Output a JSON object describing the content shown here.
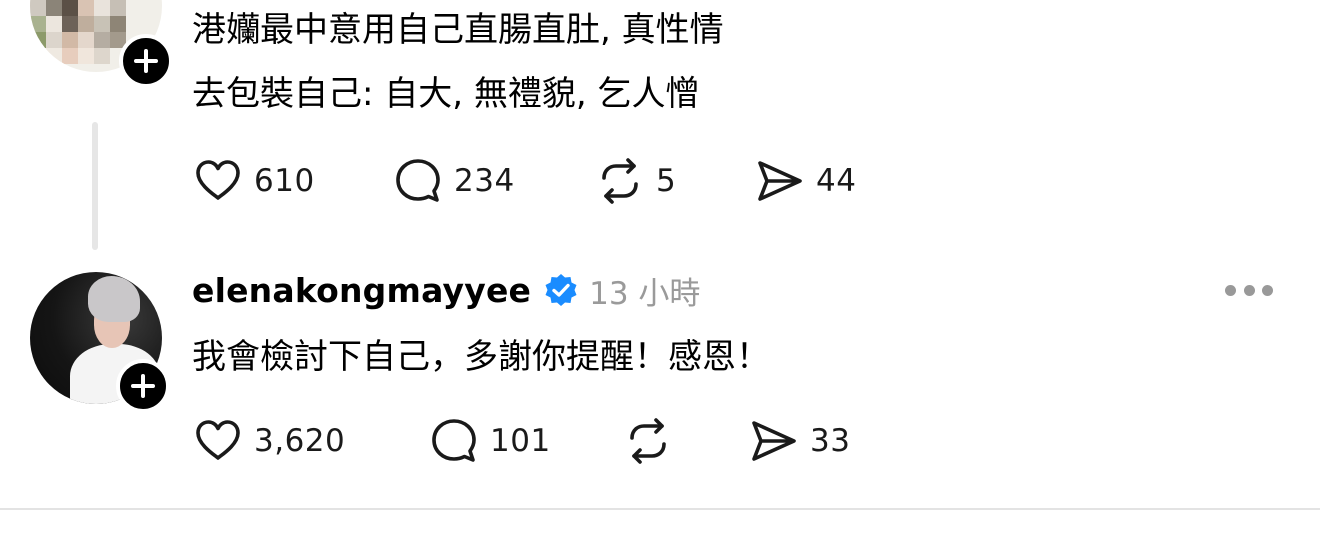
{
  "colors": {
    "background": "#ffffff",
    "text": "#000000",
    "meta_gray": "#9a9a9a",
    "verified_blue": "#1a8cff",
    "thread_line": "#e6e6e6"
  },
  "post": {
    "text_line1": "港孏最中意用自己直腸直肚, 真性情",
    "text_line2": "去包裝自己: 自大, 無禮貌, 乞人憎",
    "avatar_note": "pixelated",
    "actions": {
      "like_count": "610",
      "reply_count": "234",
      "repost_count": "5",
      "share_count": "44"
    }
  },
  "reply": {
    "username": "elenakongmayyee",
    "verified": true,
    "timestamp": "13 小時",
    "text": "我會檢討下自己，多謝你提醒！感恩！",
    "actions": {
      "like_count": "3,620",
      "reply_count": "101",
      "repost_count": "",
      "share_count": "33"
    }
  },
  "icons": {
    "like": "heart-icon",
    "reply": "comment-bubble-icon",
    "repost": "repost-icon",
    "share": "send-icon",
    "more": "more-options-icon",
    "follow": "plus-icon",
    "verified": "verified-badge-icon"
  }
}
